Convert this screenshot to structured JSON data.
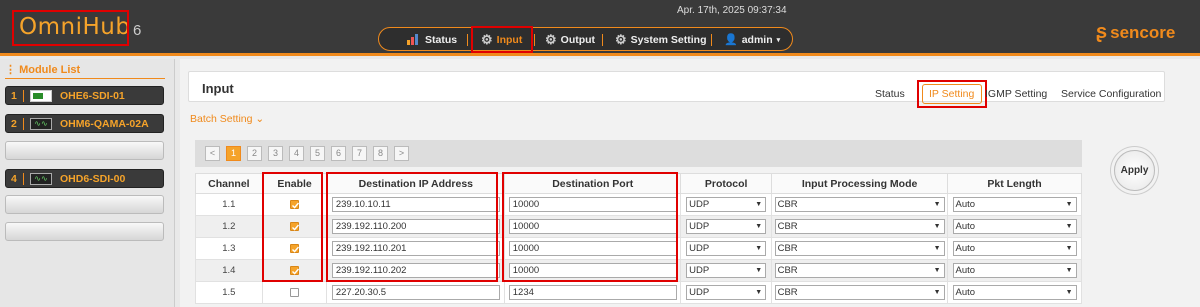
{
  "header": {
    "logo_omni": "Omni",
    "logo_hub": "Hub",
    "logo_version": "6",
    "datetime": "Apr. 17th, 2025 09:37:34",
    "brand": "sencore",
    "nav": [
      {
        "label": "Status",
        "icon": "bar-chart-icon"
      },
      {
        "label": "Input",
        "icon": "gear-icon"
      },
      {
        "label": "Output",
        "icon": "gear-icon"
      },
      {
        "label": "System Setting",
        "icon": "gear-icon"
      },
      {
        "label": "admin",
        "icon": "user-icon"
      }
    ],
    "accent_color": "#f08a1c"
  },
  "sidebar": {
    "title": "Module List",
    "modules": [
      {
        "num": "1",
        "label": "OHE6-SDI-01",
        "icon": "green-module-icon"
      },
      {
        "num": "2",
        "label": "OHM6-QAMA-02A",
        "icon": "green-module-icon"
      },
      {
        "num": "4",
        "label": "OHD6-SDI-00",
        "icon": "green-module-icon"
      }
    ]
  },
  "main": {
    "title": "Input",
    "subtabs": [
      "Status",
      "IP Setting",
      "IGMP Setting",
      "Service Configuration"
    ],
    "batch_label": "Batch Setting",
    "pager": [
      "<",
      "1",
      "2",
      "3",
      "4",
      "5",
      "6",
      "7",
      "8",
      ">"
    ],
    "apply_label": "Apply",
    "columns": [
      "Channel",
      "Enable",
      "Destination IP Address",
      "Destination Port",
      "Protocol",
      "Input Processing Mode",
      "Pkt Length"
    ],
    "rows": [
      {
        "channel": "1.1",
        "enabled": true,
        "ip": "239.10.10.11",
        "port": "10000",
        "protocol": "UDP",
        "mode": "CBR",
        "pkt": "Auto"
      },
      {
        "channel": "1.2",
        "enabled": true,
        "ip": "239.192.110.200",
        "port": "10000",
        "protocol": "UDP",
        "mode": "CBR",
        "pkt": "Auto"
      },
      {
        "channel": "1.3",
        "enabled": true,
        "ip": "239.192.110.201",
        "port": "10000",
        "protocol": "UDP",
        "mode": "CBR",
        "pkt": "Auto"
      },
      {
        "channel": "1.4",
        "enabled": true,
        "ip": "239.192.110.202",
        "port": "10000",
        "protocol": "UDP",
        "mode": "CBR",
        "pkt": "Auto"
      },
      {
        "channel": "1.5",
        "enabled": false,
        "ip": "227.20.30.5",
        "port": "1234",
        "protocol": "UDP",
        "mode": "CBR",
        "pkt": "Auto"
      }
    ]
  }
}
